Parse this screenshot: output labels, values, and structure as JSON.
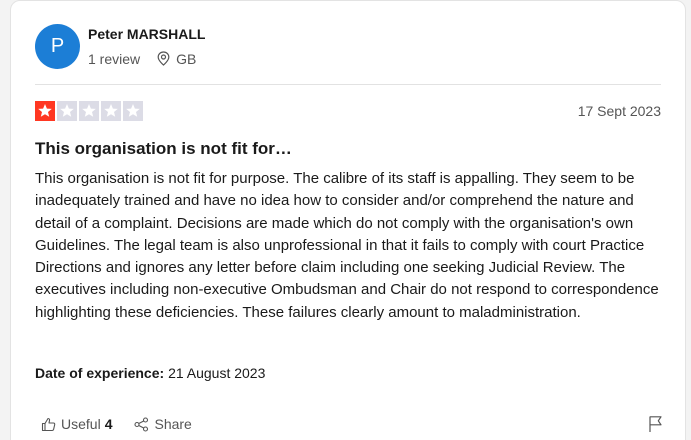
{
  "reviewer": {
    "avatar_letter": "P",
    "avatar_color": "#1c7ed6",
    "name": "Peter MARSHALL",
    "review_count": "1 review",
    "country": "GB"
  },
  "rating": {
    "value": 1,
    "max": 5,
    "filled_color": "#ff3722",
    "empty_color": "#dcdce6"
  },
  "date": "17 Sept 2023",
  "title": "This organisation is not fit for…",
  "body": "This organisation is not fit for purpose. The calibre of its staff is appalling. They seem to be inadequately trained and have no idea how to consider and/or comprehend the nature and detail of a complaint. Decisions are made which do not comply with the organisation's own Guidelines. The legal team is also unprofessional in that it fails to comply with court Practice Directions and ignores any letter before claim including one seeking Judicial Review. The executives including non-executive Ombudsman and Chair do not respond to correspondence highlighting these deficiencies. These failures clearly amount to maladministration.",
  "experience": {
    "label": "Date of experience:",
    "value": "21 August 2023"
  },
  "actions": {
    "useful_label": "Useful",
    "useful_count": "4",
    "share_label": "Share"
  },
  "icons": {
    "location": "location-pin-icon",
    "useful": "thumbs-up-icon",
    "share": "share-icon",
    "flag": "flag-icon",
    "star": "star-icon"
  }
}
